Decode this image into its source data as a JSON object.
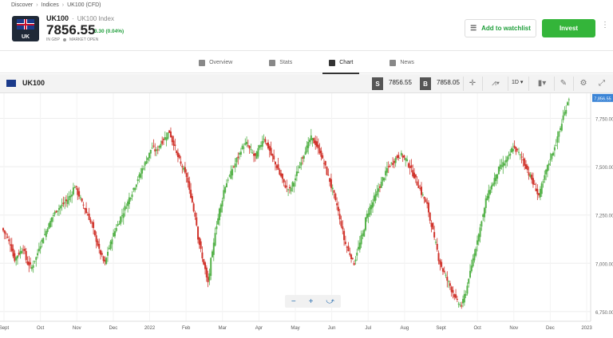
{
  "breadcrumb": {
    "discover": "Discover",
    "indices": "Indices",
    "current": "UK100 (CFD)"
  },
  "instrument": {
    "symbol": "UK100",
    "separator": "·",
    "full_name": "UK100 Index",
    "price": "7856.55",
    "change": "3.30 (0.04%)",
    "currency": "IN GBP",
    "market_status": "MARKET OPEN",
    "logo_label": "UK"
  },
  "actions": {
    "watchlist": "Add to watchlist",
    "invest": "Invest",
    "more": "⋮"
  },
  "tabs": [
    {
      "label": "Overview"
    },
    {
      "label": "Stats"
    },
    {
      "label": "Chart"
    },
    {
      "label": "News"
    }
  ],
  "toolbar": {
    "name": "UK100",
    "sell_label": "S",
    "sell_value": "7856.55",
    "buy_label": "B",
    "buy_value": "7858.05",
    "timeframe": "1D"
  },
  "colors": {
    "up": "#55b24a",
    "down": "#d0342c",
    "accent": "#34b53a",
    "price_tag": "#3a84d6"
  },
  "chart_data": {
    "type": "candlestick",
    "x_ticks": [
      "Sept",
      "Oct",
      "Nov",
      "Dec",
      "2022",
      "Feb",
      "Mar",
      "Apr",
      "May",
      "Jun",
      "Jul",
      "Aug",
      "Sept",
      "Oct",
      "Nov",
      "Dec",
      "2023"
    ],
    "y_ticks": [
      "7,750.00",
      "7,500.00",
      "7,250.00",
      "7,000.00",
      "6,750.00"
    ],
    "ylim": [
      6700,
      7880
    ],
    "last_price": "7,856.55",
    "close_path": [
      7180,
      7150,
      7100,
      7020,
      7050,
      7080,
      7000,
      6980,
      7030,
      7100,
      7150,
      7200,
      7250,
      7280,
      7300,
      7320,
      7350,
      7400,
      7350,
      7300,
      7250,
      7200,
      7120,
      7050,
      7000,
      7080,
      7150,
      7200,
      7250,
      7300,
      7350,
      7400,
      7450,
      7500,
      7550,
      7600,
      7580,
      7620,
      7650,
      7680,
      7620,
      7550,
      7500,
      7450,
      7350,
      7250,
      7100,
      7000,
      6900,
      7050,
      7200,
      7300,
      7400,
      7450,
      7500,
      7550,
      7600,
      7620,
      7580,
      7550,
      7600,
      7650,
      7600,
      7550,
      7500,
      7450,
      7400,
      7380,
      7420,
      7480,
      7550,
      7600,
      7650,
      7620,
      7580,
      7520,
      7450,
      7380,
      7300,
      7200,
      7100,
      7050,
      7000,
      7080,
      7150,
      7250,
      7300,
      7350,
      7400,
      7450,
      7500,
      7520,
      7550,
      7560,
      7540,
      7500,
      7450,
      7400,
      7350,
      7300,
      7200,
      7100,
      7000,
      6950,
      6900,
      6850,
      6800,
      6780,
      6850,
      6950,
      7050,
      7150,
      7250,
      7350,
      7400,
      7450,
      7500,
      7520,
      7550,
      7600,
      7580,
      7550,
      7500,
      7450,
      7400,
      7350,
      7420,
      7500,
      7560,
      7620,
      7700,
      7780,
      7856
    ]
  },
  "zoom": {
    "minus": "−",
    "plus": "+",
    "share": "share"
  }
}
